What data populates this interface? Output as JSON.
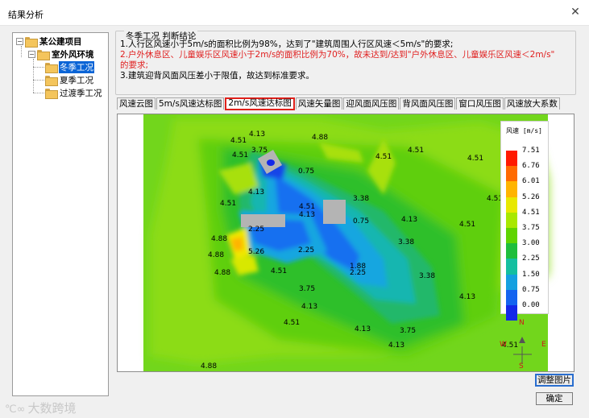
{
  "window": {
    "title": "结果分析",
    "close_label": "✕"
  },
  "tree": {
    "root": "某公建项目",
    "group": "室外风环境",
    "items": [
      "冬季工况",
      "夏季工况",
      "过渡季工况"
    ],
    "selected_index": 0
  },
  "conclusion": {
    "title": "冬季工况 判断结论",
    "line1": "1.人行区风速小于5m/s的面积比例为98%，达到了\"建筑周围人行区风速＜5m/s\"的要求;",
    "line2a": "2.户外休息区、儿童娱乐区风速小于2m/s的面积比例为70%，故未达到/达到\"户外休息区、儿童娱乐区风速＜2m/s\"",
    "line2b": "的要求;",
    "line3": "3.建筑迎背风面风压差小于限值，故达到标准要求。"
  },
  "tabs": [
    "风速云图",
    "5m/s风速达标图",
    "2m/s风速达标图",
    "风速矢量图",
    "迎风面风压图",
    "背风面风压图",
    "窗口风压图",
    "风速放大系数"
  ],
  "active_tab": 2,
  "legend": {
    "title": "风速 [m/s]",
    "values": [
      "7.51",
      "6.76",
      "6.01",
      "5.26",
      "4.51",
      "3.75",
      "3.00",
      "2.25",
      "1.50",
      "0.75",
      "0.00"
    ],
    "colors": [
      "#ff1a00",
      "#ff6a00",
      "#ffb400",
      "#e8e800",
      "#a8e800",
      "#5fd400",
      "#1ebe3c",
      "#14bfa0",
      "#14a0e0",
      "#1464f0",
      "#1428e8"
    ]
  },
  "map_labels": [
    "4.13",
    "4.51",
    "3.75",
    "4.51",
    "4.88",
    "4.51",
    "4.51",
    "4.51",
    "0.75",
    "4.13",
    "3.38",
    "4.51",
    "4.51",
    "4.13",
    "0.75",
    "4.51",
    "4.13",
    "2.25",
    "4.51",
    "4.88",
    "3.38",
    "4.88",
    "5.26",
    "2.25",
    "1.88",
    "2.25",
    "3.38",
    "4.88",
    "4.51",
    "3.75",
    "4.13",
    "4.13",
    "4.51",
    "4.13",
    "3.75",
    "4.13",
    "4.51",
    "4.88"
  ],
  "compass": {
    "n": "N",
    "s": "S",
    "e": "E",
    "w": "W"
  },
  "buttons": {
    "adjust": "调整图片",
    "ok": "确定"
  },
  "watermark": "大数跨境"
}
